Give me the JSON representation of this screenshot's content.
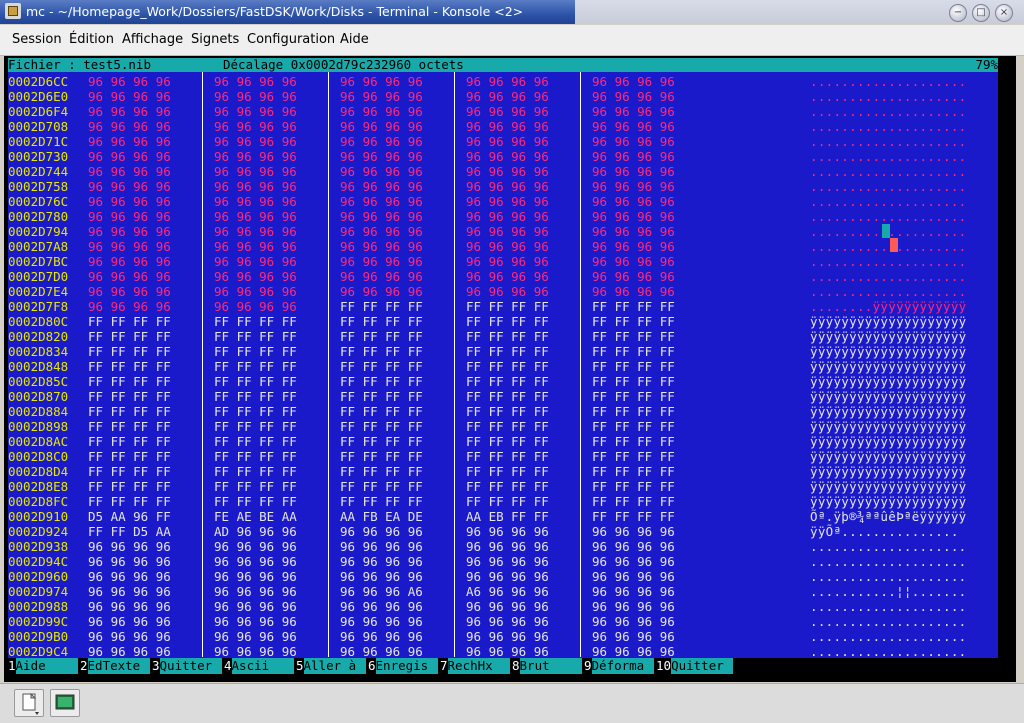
{
  "window": {
    "title": "mc - ~/Homepage_Work/Dossiers/FastDSK/Work/Disks - Terminal - Konsole <2>",
    "buttons": [
      "minimize-icon",
      "maximize-icon",
      "close-icon"
    ]
  },
  "menubar": {
    "items": [
      "Session",
      "Édition",
      "Affichage",
      "Signets",
      "Configuration",
      "Aide"
    ]
  },
  "viewer": {
    "file_label": "Fichier : test5.nib",
    "offset_label": "Décalage 0x0002d79c232960 octets",
    "percent": "79%",
    "rows": [
      {
        "addr": "0002D6CC",
        "g": [
          "96 96 96 96",
          "96 96 96 96",
          "96 96 96 96",
          "96 96 96 96",
          "96 96 96 96"
        ],
        "asc": "....................",
        "pink": [
          1,
          1,
          1,
          1,
          1
        ]
      },
      {
        "addr": "0002D6E0",
        "g": [
          "96 96 96 96",
          "96 96 96 96",
          "96 96 96 96",
          "96 96 96 96",
          "96 96 96 96"
        ],
        "asc": "....................",
        "pink": [
          1,
          1,
          1,
          1,
          1
        ]
      },
      {
        "addr": "0002D6F4",
        "g": [
          "96 96 96 96",
          "96 96 96 96",
          "96 96 96 96",
          "96 96 96 96",
          "96 96 96 96"
        ],
        "asc": "....................",
        "pink": [
          1,
          1,
          1,
          1,
          1
        ]
      },
      {
        "addr": "0002D708",
        "g": [
          "96 96 96 96",
          "96 96 96 96",
          "96 96 96 96",
          "96 96 96 96",
          "96 96 96 96"
        ],
        "asc": "....................",
        "pink": [
          1,
          1,
          1,
          1,
          1
        ]
      },
      {
        "addr": "0002D71C",
        "g": [
          "96 96 96 96",
          "96 96 96 96",
          "96 96 96 96",
          "96 96 96 96",
          "96 96 96 96"
        ],
        "asc": "....................",
        "pink": [
          1,
          1,
          1,
          1,
          1
        ]
      },
      {
        "addr": "0002D730",
        "g": [
          "96 96 96 96",
          "96 96 96 96",
          "96 96 96 96",
          "96 96 96 96",
          "96 96 96 96"
        ],
        "asc": "....................",
        "pink": [
          1,
          1,
          1,
          1,
          1
        ]
      },
      {
        "addr": "0002D744",
        "g": [
          "96 96 96 96",
          "96 96 96 96",
          "96 96 96 96",
          "96 96 96 96",
          "96 96 96 96"
        ],
        "asc": "....................",
        "pink": [
          1,
          1,
          1,
          1,
          1
        ]
      },
      {
        "addr": "0002D758",
        "g": [
          "96 96 96 96",
          "96 96 96 96",
          "96 96 96 96",
          "96 96 96 96",
          "96 96 96 96"
        ],
        "asc": "....................",
        "pink": [
          1,
          1,
          1,
          1,
          1
        ]
      },
      {
        "addr": "0002D76C",
        "g": [
          "96 96 96 96",
          "96 96 96 96",
          "96 96 96 96",
          "96 96 96 96",
          "96 96 96 96"
        ],
        "asc": "....................",
        "pink": [
          1,
          1,
          1,
          1,
          1
        ]
      },
      {
        "addr": "0002D780",
        "g": [
          "96 96 96 96",
          "96 96 96 96",
          "96 96 96 96",
          "96 96 96 96",
          "96 96 96 96"
        ],
        "asc": "....................",
        "pink": [
          1,
          1,
          1,
          1,
          1
        ]
      },
      {
        "addr": "0002D794",
        "g": [
          "96 96 96 96",
          "96 96 96 96",
          "96 96 96 96",
          "96 96 96 96",
          "96 96 96 96"
        ],
        "asc": "....................",
        "pink": [
          1,
          1,
          1,
          1,
          1
        ]
      },
      {
        "addr": "0002D7A8",
        "g": [
          "96 96 96 96",
          "96 96 96 96",
          "96 96 96 96",
          "96 96 96 96",
          "96 96 96 96"
        ],
        "asc": "....................",
        "pink": [
          1,
          1,
          1,
          1,
          1
        ]
      },
      {
        "addr": "0002D7BC",
        "g": [
          "96 96 96 96",
          "96 96 96 96",
          "96 96 96 96",
          "96 96 96 96",
          "96 96 96 96"
        ],
        "asc": "....................",
        "pink": [
          1,
          1,
          1,
          1,
          1
        ]
      },
      {
        "addr": "0002D7D0",
        "g": [
          "96 96 96 96",
          "96 96 96 96",
          "96 96 96 96",
          "96 96 96 96",
          "96 96 96 96"
        ],
        "asc": "....................",
        "pink": [
          1,
          1,
          1,
          1,
          1
        ]
      },
      {
        "addr": "0002D7E4",
        "g": [
          "96 96 96 96",
          "96 96 96 96",
          "96 96 96 96",
          "96 96 96 96",
          "96 96 96 96"
        ],
        "asc": "....................",
        "pink": [
          1,
          1,
          1,
          1,
          1
        ]
      },
      {
        "addr": "0002D7F8",
        "g": [
          "96 96 96 96",
          "96 96 96 96",
          "FF FF FF FF",
          "FF FF FF FF",
          "FF FF FF FF"
        ],
        "asc": "........ÿÿÿÿÿÿÿÿÿÿÿÿ",
        "pink": [
          1,
          1,
          0,
          0,
          0
        ]
      },
      {
        "addr": "0002D80C",
        "g": [
          "FF FF FF FF",
          "FF FF FF FF",
          "FF FF FF FF",
          "FF FF FF FF",
          "FF FF FF FF"
        ],
        "asc": "ÿÿÿÿÿÿÿÿÿÿÿÿÿÿÿÿÿÿÿÿ",
        "pink": [
          0,
          0,
          0,
          0,
          0
        ]
      },
      {
        "addr": "0002D820",
        "g": [
          "FF FF FF FF",
          "FF FF FF FF",
          "FF FF FF FF",
          "FF FF FF FF",
          "FF FF FF FF"
        ],
        "asc": "ÿÿÿÿÿÿÿÿÿÿÿÿÿÿÿÿÿÿÿÿ",
        "pink": [
          0,
          0,
          0,
          0,
          0
        ]
      },
      {
        "addr": "0002D834",
        "g": [
          "FF FF FF FF",
          "FF FF FF FF",
          "FF FF FF FF",
          "FF FF FF FF",
          "FF FF FF FF"
        ],
        "asc": "ÿÿÿÿÿÿÿÿÿÿÿÿÿÿÿÿÿÿÿÿ",
        "pink": [
          0,
          0,
          0,
          0,
          0
        ]
      },
      {
        "addr": "0002D848",
        "g": [
          "FF FF FF FF",
          "FF FF FF FF",
          "FF FF FF FF",
          "FF FF FF FF",
          "FF FF FF FF"
        ],
        "asc": "ÿÿÿÿÿÿÿÿÿÿÿÿÿÿÿÿÿÿÿÿ",
        "pink": [
          0,
          0,
          0,
          0,
          0
        ]
      },
      {
        "addr": "0002D85C",
        "g": [
          "FF FF FF FF",
          "FF FF FF FF",
          "FF FF FF FF",
          "FF FF FF FF",
          "FF FF FF FF"
        ],
        "asc": "ÿÿÿÿÿÿÿÿÿÿÿÿÿÿÿÿÿÿÿÿ",
        "pink": [
          0,
          0,
          0,
          0,
          0
        ]
      },
      {
        "addr": "0002D870",
        "g": [
          "FF FF FF FF",
          "FF FF FF FF",
          "FF FF FF FF",
          "FF FF FF FF",
          "FF FF FF FF"
        ],
        "asc": "ÿÿÿÿÿÿÿÿÿÿÿÿÿÿÿÿÿÿÿÿ",
        "pink": [
          0,
          0,
          0,
          0,
          0
        ]
      },
      {
        "addr": "0002D884",
        "g": [
          "FF FF FF FF",
          "FF FF FF FF",
          "FF FF FF FF",
          "FF FF FF FF",
          "FF FF FF FF"
        ],
        "asc": "ÿÿÿÿÿÿÿÿÿÿÿÿÿÿÿÿÿÿÿÿ",
        "pink": [
          0,
          0,
          0,
          0,
          0
        ]
      },
      {
        "addr": "0002D898",
        "g": [
          "FF FF FF FF",
          "FF FF FF FF",
          "FF FF FF FF",
          "FF FF FF FF",
          "FF FF FF FF"
        ],
        "asc": "ÿÿÿÿÿÿÿÿÿÿÿÿÿÿÿÿÿÿÿÿ",
        "pink": [
          0,
          0,
          0,
          0,
          0
        ]
      },
      {
        "addr": "0002D8AC",
        "g": [
          "FF FF FF FF",
          "FF FF FF FF",
          "FF FF FF FF",
          "FF FF FF FF",
          "FF FF FF FF"
        ],
        "asc": "ÿÿÿÿÿÿÿÿÿÿÿÿÿÿÿÿÿÿÿÿ",
        "pink": [
          0,
          0,
          0,
          0,
          0
        ]
      },
      {
        "addr": "0002D8C0",
        "g": [
          "FF FF FF FF",
          "FF FF FF FF",
          "FF FF FF FF",
          "FF FF FF FF",
          "FF FF FF FF"
        ],
        "asc": "ÿÿÿÿÿÿÿÿÿÿÿÿÿÿÿÿÿÿÿÿ",
        "pink": [
          0,
          0,
          0,
          0,
          0
        ]
      },
      {
        "addr": "0002D8D4",
        "g": [
          "FF FF FF FF",
          "FF FF FF FF",
          "FF FF FF FF",
          "FF FF FF FF",
          "FF FF FF FF"
        ],
        "asc": "ÿÿÿÿÿÿÿÿÿÿÿÿÿÿÿÿÿÿÿÿ",
        "pink": [
          0,
          0,
          0,
          0,
          0
        ]
      },
      {
        "addr": "0002D8E8",
        "g": [
          "FF FF FF FF",
          "FF FF FF FF",
          "FF FF FF FF",
          "FF FF FF FF",
          "FF FF FF FF"
        ],
        "asc": "ÿÿÿÿÿÿÿÿÿÿÿÿÿÿÿÿÿÿÿÿ",
        "pink": [
          0,
          0,
          0,
          0,
          0
        ]
      },
      {
        "addr": "0002D8FC",
        "g": [
          "FF FF FF FF",
          "FF FF FF FF",
          "FF FF FF FF",
          "FF FF FF FF",
          "FF FF FF FF"
        ],
        "asc": "ÿÿÿÿÿÿÿÿÿÿÿÿÿÿÿÿÿÿÿÿ",
        "pink": [
          0,
          0,
          0,
          0,
          0
        ]
      },
      {
        "addr": "0002D910",
        "g": [
          "D5 AA 96 FF",
          "FE AE BE AA",
          "AA FB EA DE",
          "AA EB FF FF",
          "FF FF FF FF"
        ],
        "asc": "Õª.ÿþ®¾ªªûêÞªëÿÿÿÿÿÿ",
        "pink": [
          0,
          0,
          0,
          0,
          0
        ]
      },
      {
        "addr": "0002D924",
        "g": [
          "FF FF D5 AA",
          "AD 96 96 96",
          "96 96 96 96",
          "96 96 96 96",
          "96 96 96 96"
        ],
        "asc": "ÿÿÕª­...............",
        "pink": [
          0,
          0,
          0,
          0,
          0
        ]
      },
      {
        "addr": "0002D938",
        "g": [
          "96 96 96 96",
          "96 96 96 96",
          "96 96 96 96",
          "96 96 96 96",
          "96 96 96 96"
        ],
        "asc": "....................",
        "pink": [
          0,
          0,
          0,
          0,
          0
        ]
      },
      {
        "addr": "0002D94C",
        "g": [
          "96 96 96 96",
          "96 96 96 96",
          "96 96 96 96",
          "96 96 96 96",
          "96 96 96 96"
        ],
        "asc": "....................",
        "pink": [
          0,
          0,
          0,
          0,
          0
        ]
      },
      {
        "addr": "0002D960",
        "g": [
          "96 96 96 96",
          "96 96 96 96",
          "96 96 96 96",
          "96 96 96 96",
          "96 96 96 96"
        ],
        "asc": "....................",
        "pink": [
          0,
          0,
          0,
          0,
          0
        ]
      },
      {
        "addr": "0002D974",
        "g": [
          "96 96 96 96",
          "96 96 96 96",
          "96 96 96 A6",
          "A6 96 96 96",
          "96 96 96 96"
        ],
        "asc": "...........¦¦.......",
        "pink": [
          0,
          0,
          0,
          0,
          0
        ]
      },
      {
        "addr": "0002D988",
        "g": [
          "96 96 96 96",
          "96 96 96 96",
          "96 96 96 96",
          "96 96 96 96",
          "96 96 96 96"
        ],
        "asc": "....................",
        "pink": [
          0,
          0,
          0,
          0,
          0
        ]
      },
      {
        "addr": "0002D99C",
        "g": [
          "96 96 96 96",
          "96 96 96 96",
          "96 96 96 96",
          "96 96 96 96",
          "96 96 96 96"
        ],
        "asc": "....................",
        "pink": [
          0,
          0,
          0,
          0,
          0
        ]
      },
      {
        "addr": "0002D9B0",
        "g": [
          "96 96 96 96",
          "96 96 96 96",
          "96 96 96 96",
          "96 96 96 96",
          "96 96 96 96"
        ],
        "asc": "....................",
        "pink": [
          0,
          0,
          0,
          0,
          0
        ]
      },
      {
        "addr": "0002D9C4",
        "g": [
          "96 96 96 96",
          "96 96 96 96",
          "96 96 96 96",
          "96 96 96 96",
          "96 96 96 96"
        ],
        "asc": "....................",
        "pink": [
          0,
          0,
          0,
          0,
          0
        ]
      }
    ]
  },
  "fkeys": [
    {
      "num": "1",
      "label": "Aide"
    },
    {
      "num": "2",
      "label": "EdTexte"
    },
    {
      "num": "3",
      "label": "Quitter"
    },
    {
      "num": "4",
      "label": "Ascii"
    },
    {
      "num": "5",
      "label": "Aller à"
    },
    {
      "num": "6",
      "label": "Enregis"
    },
    {
      "num": "7",
      "label": "RechHx"
    },
    {
      "num": "8",
      "label": "Brut"
    },
    {
      "num": "9",
      "label": "Déforma"
    },
    {
      "num": "10",
      "label": "Quitter"
    }
  ],
  "colors": {
    "background": "#1a1acb",
    "header": "#18aaaa",
    "address": "#e8e800",
    "highlight": "#ff2a7a"
  },
  "bottombar": {
    "buttons": [
      "new-session-icon",
      "terminal-icon"
    ]
  }
}
